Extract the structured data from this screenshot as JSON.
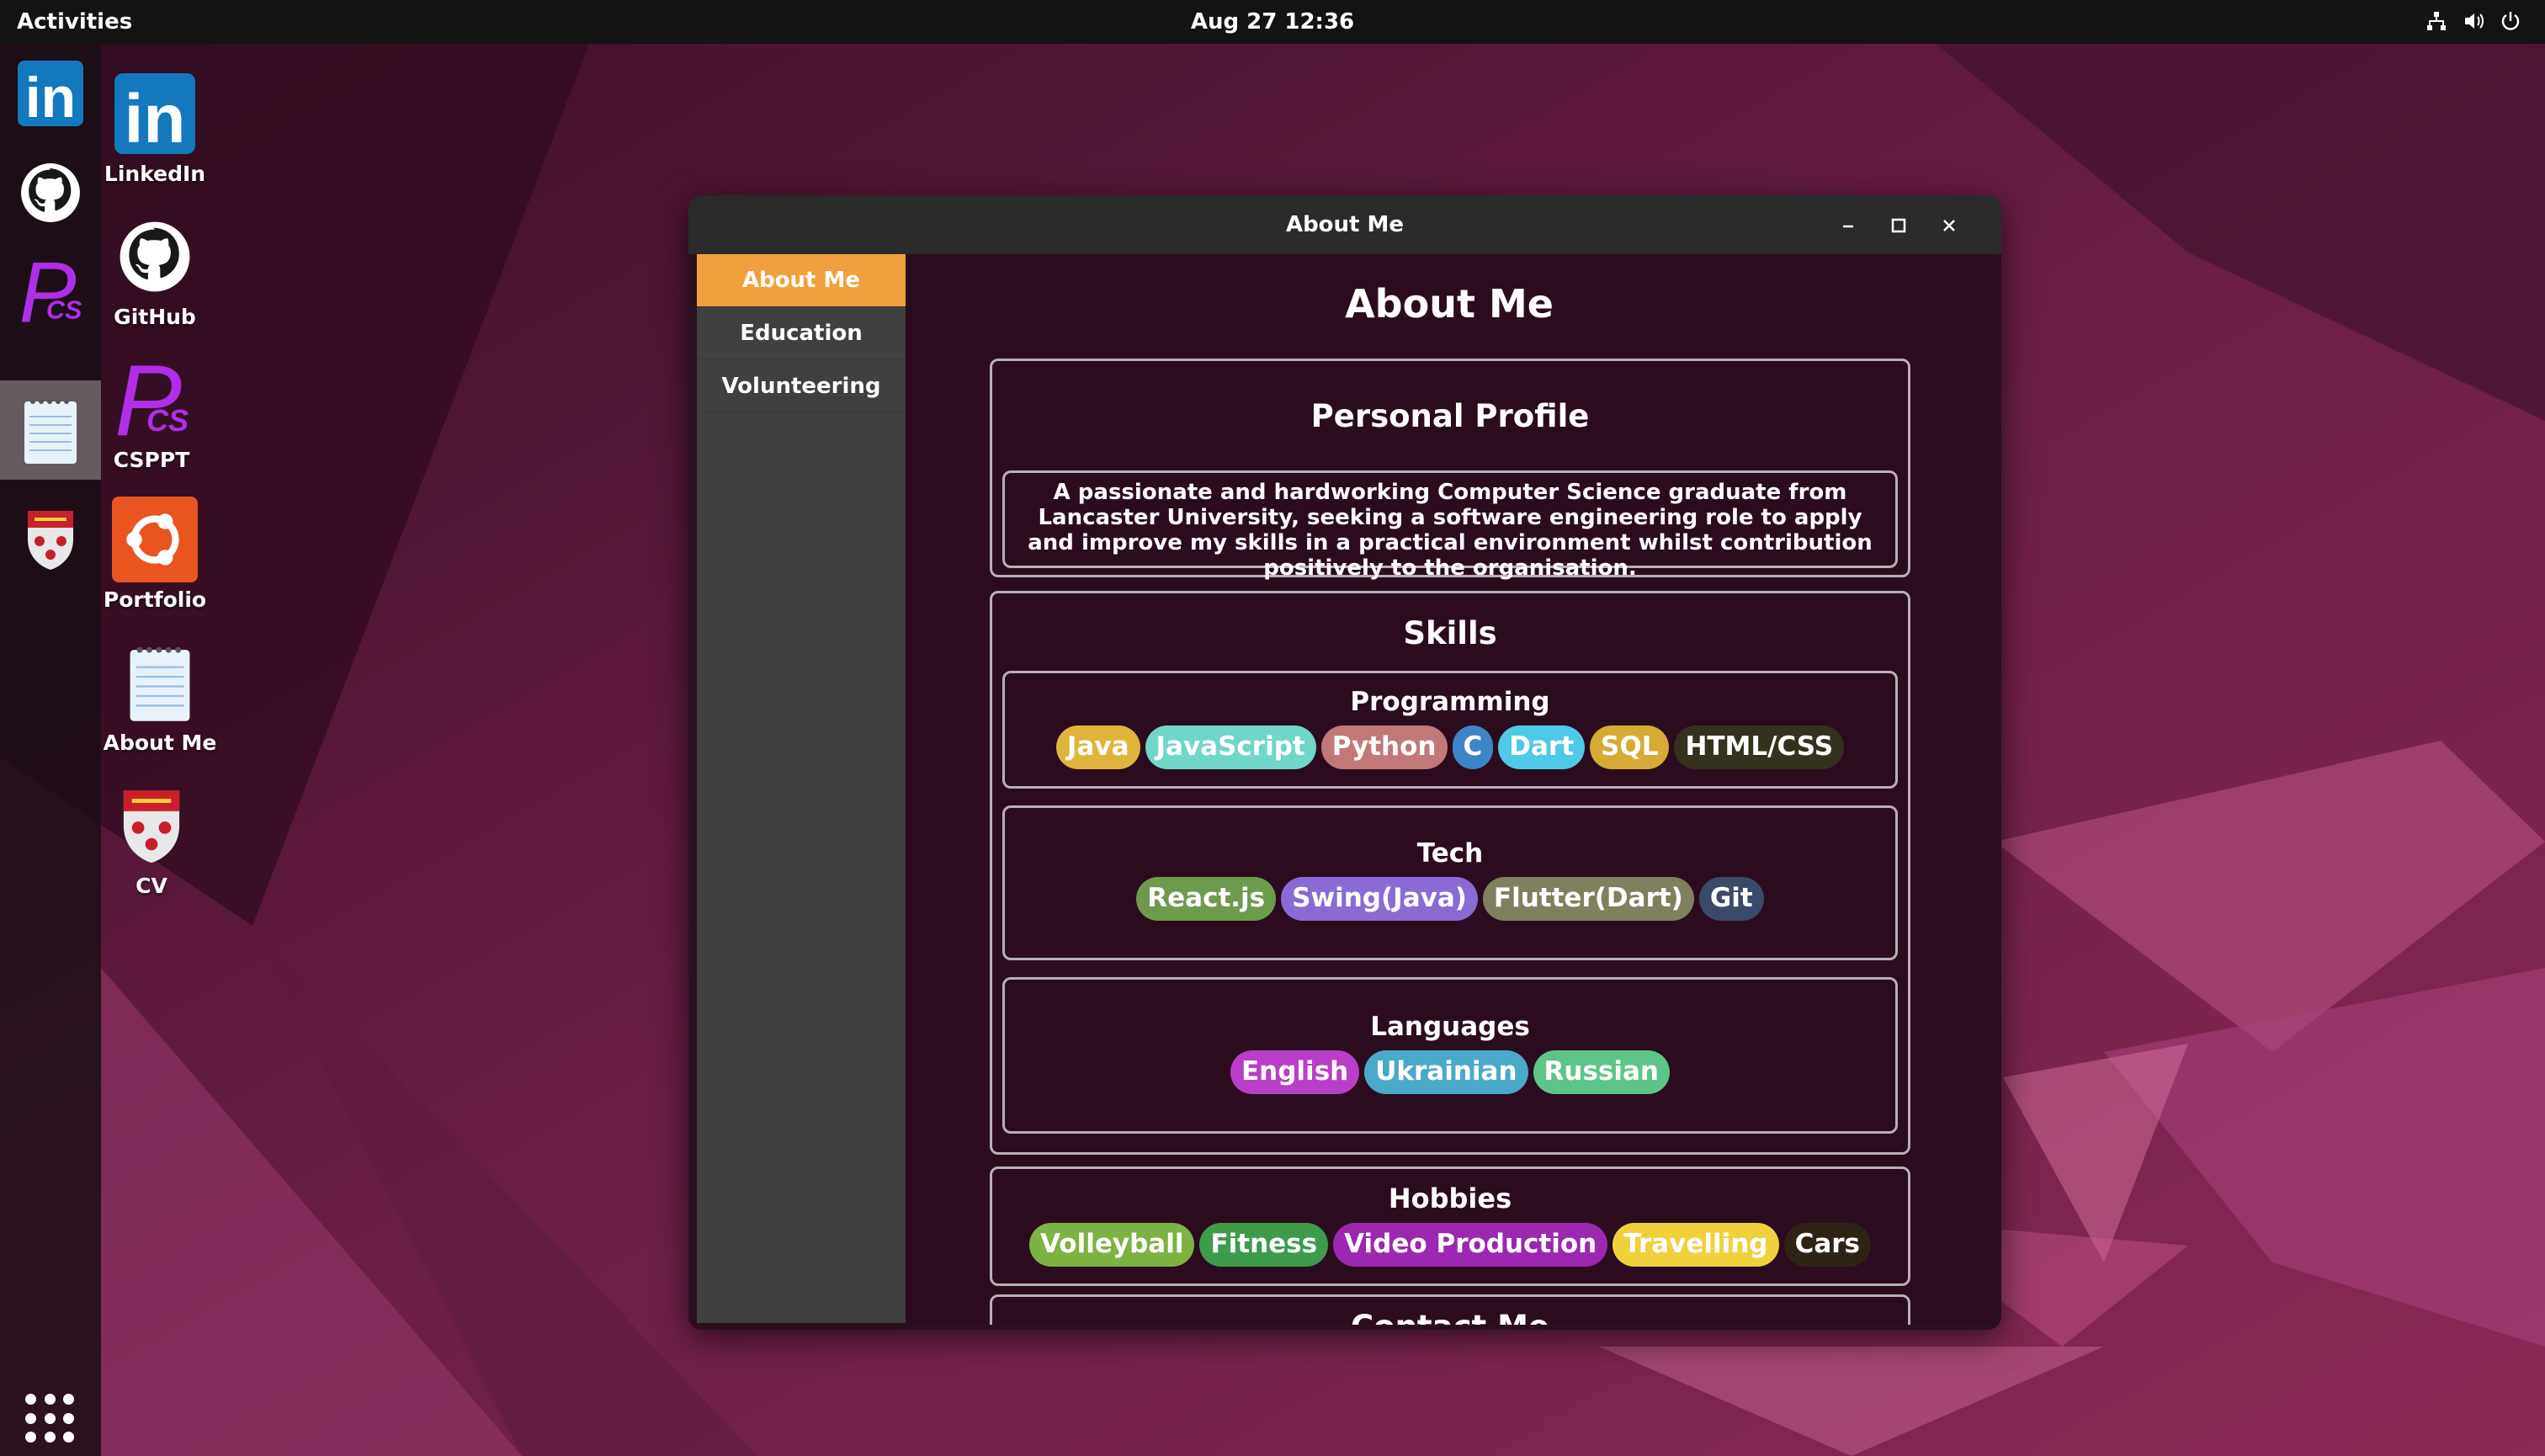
{
  "topbar": {
    "activities": "Activities",
    "clock": "Aug 27  12:36"
  },
  "dock": [
    {
      "name": "linkedin",
      "icon": "linkedin-icon"
    },
    {
      "name": "github",
      "icon": "github-icon"
    },
    {
      "name": "csppt",
      "icon": "cs-ppt-icon"
    },
    {
      "name": "text-editor",
      "icon": "notepad-icon",
      "active": true
    },
    {
      "name": "cv",
      "icon": "university-crest-icon"
    }
  ],
  "desktop": {
    "linkedin": "LinkedIn",
    "github": "GitHub",
    "csppt": "CSPPT",
    "portfolio": "Portfolio",
    "about": "About Me",
    "cv": "CV"
  },
  "window": {
    "title": "About Me",
    "nav": [
      "About Me",
      "Education",
      "Volunteering"
    ],
    "heading": "About Me",
    "profile": {
      "title": "Personal Profile",
      "text": "A passionate and hardworking Computer Science graduate from Lancaster University, seeking a software engineering role to apply and improve my skills in a practical environment whilst contribution positively to the organisation."
    },
    "skills": {
      "title": "Skills",
      "programming": {
        "title": "Programming",
        "tags": [
          {
            "label": "Java",
            "color": "#e0b43c"
          },
          {
            "label": "JavaScript",
            "color": "#6fd6c8"
          },
          {
            "label": "Python",
            "color": "#c27878"
          },
          {
            "label": "C",
            "color": "#3d85c6"
          },
          {
            "label": "Dart",
            "color": "#4fc9e8"
          },
          {
            "label": "SQL",
            "color": "#d6aa34"
          },
          {
            "label": "HTML/CSS",
            "color": "#34321e"
          }
        ]
      },
      "tech": {
        "title": "Tech",
        "tags": [
          {
            "label": "React.js",
            "color": "#6e9a4e"
          },
          {
            "label": "Swing(Java)",
            "color": "#8a6bd6"
          },
          {
            "label": "Flutter(Dart)",
            "color": "#7f8060"
          },
          {
            "label": "Git",
            "color": "#3c4a6a"
          }
        ]
      },
      "languages": {
        "title": "Languages",
        "tags": [
          {
            "label": "English",
            "color": "#b93ec8"
          },
          {
            "label": "Ukrainian",
            "color": "#4aa9c9"
          },
          {
            "label": "Russian",
            "color": "#5ec489"
          }
        ]
      }
    },
    "hobbies": {
      "title": "Hobbies",
      "tags": [
        {
          "label": "Volleyball",
          "color": "#7cb342"
        },
        {
          "label": "Fitness",
          "color": "#3e9b4a"
        },
        {
          "label": "Video Production",
          "color": "#9c27b0"
        },
        {
          "label": "Travelling",
          "color": "#f0d13c"
        },
        {
          "label": "Cars",
          "color": "#2d2416"
        }
      ]
    },
    "next_section": "Contact Me"
  }
}
